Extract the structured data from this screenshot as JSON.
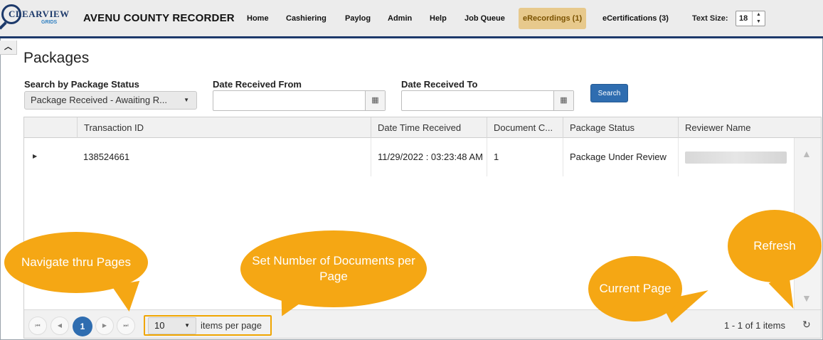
{
  "header": {
    "logo_text": "CLEARVIEW",
    "logo_sub": "GRIDS",
    "app_title": "AVENU COUNTY RECORDER",
    "nav": [
      "Home",
      "Cashiering",
      "Paylog",
      "Admin",
      "Help",
      "Job Queue",
      "eRecordings (1)",
      "eCertifications (3)"
    ],
    "active_nav": "eRecordings (1)",
    "text_size_label": "Text Size:",
    "text_size_value": "18"
  },
  "page": {
    "title": "Packages"
  },
  "filters": {
    "status_label": "Search by Package Status",
    "status_value": "Package Received - Awaiting R...",
    "from_label": "Date Received From",
    "from_value": "",
    "to_label": "Date Received To",
    "to_value": "",
    "search_button": "Search"
  },
  "grid": {
    "columns": [
      "Transaction ID",
      "Date Time Received",
      "Document C...",
      "Package Status",
      "Reviewer Name"
    ],
    "rows": [
      {
        "transaction_id": "138524661",
        "date_time": "11/29/2022 : 03:23:48 AM",
        "document_count": "1",
        "package_status": "Package Under Review",
        "reviewer_name": ""
      }
    ]
  },
  "pager": {
    "current_page": "1",
    "page_size": "10",
    "items_per_page_label": "items per page",
    "info": "1 - 1 of 1 items"
  },
  "callouts": {
    "navigate": "Navigate thru Pages",
    "page_size": "Set Number of Documents per Page",
    "current_page": "Current Page",
    "refresh": "Refresh"
  },
  "colors": {
    "header_bar": "#1d3a6b",
    "active_tab": "#e7c98c",
    "primary_button": "#2f6db0",
    "callout": "#f5a714"
  }
}
